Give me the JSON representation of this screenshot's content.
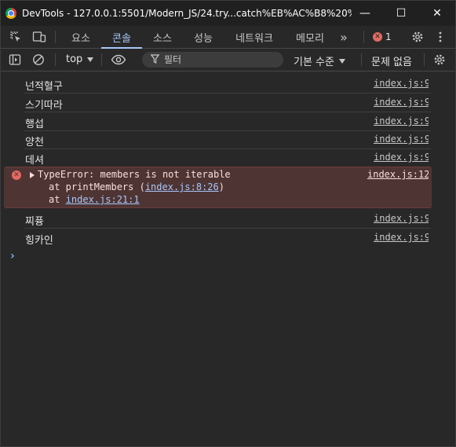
{
  "window": {
    "title": "DevTools - 127.0.0.1:5501/Modern_JS/24.try...catch%EB%AC%B8%20%ED%...",
    "minimize": "—",
    "maximize": "☐",
    "close": "✕"
  },
  "tabs": [
    {
      "label": "요소"
    },
    {
      "label": "콘솔"
    },
    {
      "label": "소스"
    },
    {
      "label": "성능"
    },
    {
      "label": "네트워크"
    },
    {
      "label": "메모리"
    }
  ],
  "overflow_icon": "»",
  "error_badge": {
    "count": "1",
    "icon": "✕"
  },
  "toolbar": {
    "context": "top",
    "filter_placeholder": "필터",
    "levels": "기본 수준",
    "issues": "문제 없음"
  },
  "messages": [
    {
      "text": "넌적혈구",
      "source": "index.js:9"
    },
    {
      "text": "스기따라",
      "source": "index.js:9"
    },
    {
      "text": "행섭",
      "source": "index.js:9"
    },
    {
      "text": "양천",
      "source": "index.js:9"
    },
    {
      "text": "데셔",
      "source": "index.js:9"
    }
  ],
  "error": {
    "icon": "✕",
    "line1": "TypeError: members is not iterable",
    "line2_prefix": "at printMembers (",
    "line2_link": "index.js:8:26",
    "line2_suffix": ")",
    "line3_prefix": "at ",
    "line3_link": "index.js:21:1",
    "source": "index.js:12"
  },
  "messages_after": [
    {
      "text": "찌퓽",
      "source": "index.js:9"
    },
    {
      "text": "힝카인",
      "source": "index.js:9"
    }
  ],
  "prompt": "›",
  "colors": {
    "accent": "#a8c7fa",
    "error": "#e46962",
    "error_bg": "#4e3534",
    "background": "#282828"
  }
}
